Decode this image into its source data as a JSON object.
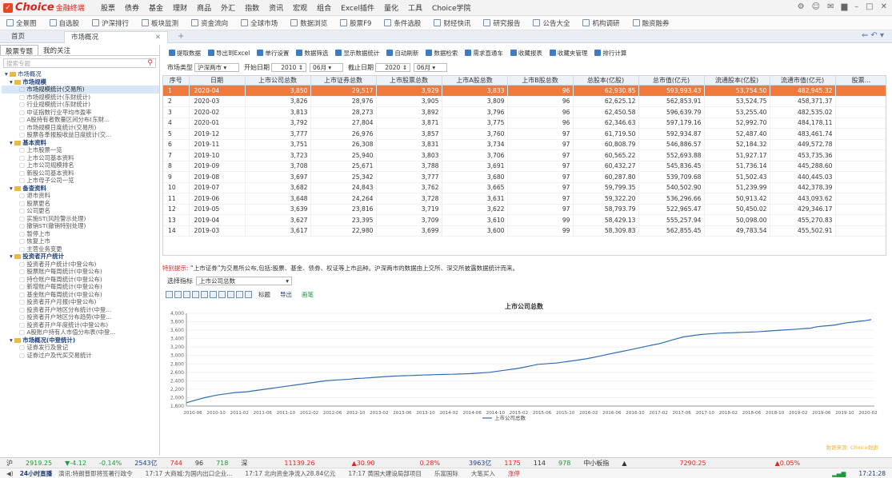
{
  "app": {
    "brand": "Choice",
    "brand_sub": "金融终端"
  },
  "menu": [
    "股票",
    "债券",
    "基金",
    "理财",
    "商品",
    "外汇",
    "指数",
    "资讯",
    "宏观",
    "组合",
    "Excel插件",
    "量化",
    "工具",
    "Choice学院"
  ],
  "toolbar": [
    "全景图",
    "自选股",
    "沪深排行",
    "板块监测",
    "资金流向",
    "全球市场",
    "数据浏览",
    "股票F9",
    "条件选股",
    "财经快讯",
    "研究报告",
    "公告大全",
    "机构调研",
    "融资融券"
  ],
  "tabs": {
    "home": "首页",
    "market": "市场概况"
  },
  "left": {
    "tab1": "股票专题",
    "tab2": "我的关注",
    "search_placeholder": "搜索专题"
  },
  "tree": [
    {
      "lv": "l0",
      "t": "市场概况"
    },
    {
      "lv": "l1",
      "t": "市场规模"
    },
    {
      "lv": "l2",
      "t": "市场规模统计(交易所)",
      "sel": true
    },
    {
      "lv": "l2",
      "t": "市场规模统计(东财统计)"
    },
    {
      "lv": "l2",
      "t": "行业规模统计(东财统计)"
    },
    {
      "lv": "l2",
      "t": "中证指数行业平均市盈率"
    },
    {
      "lv": "l2",
      "t": "A股持有者数量区间分布(东财..."
    },
    {
      "lv": "l2",
      "t": "市场规模日度统计(交易所)"
    },
    {
      "lv": "l2",
      "t": "股票各季报股收益日度统计(交..."
    },
    {
      "lv": "l1",
      "t": "基本资料"
    },
    {
      "lv": "l2",
      "t": "上市股票一览"
    },
    {
      "lv": "l2",
      "t": "上市公司基本资料"
    },
    {
      "lv": "l2",
      "t": "上市公司规模排名"
    },
    {
      "lv": "l2",
      "t": "新股公司基本资料"
    },
    {
      "lv": "l2",
      "t": "上市母子公司一览"
    },
    {
      "lv": "l1",
      "t": "备查资料"
    },
    {
      "lv": "l2",
      "t": "退市资料"
    },
    {
      "lv": "l2",
      "t": "股票更名"
    },
    {
      "lv": "l2",
      "t": "公司更名"
    },
    {
      "lv": "l2",
      "t": "实施ST(风险警示处理)"
    },
    {
      "lv": "l2",
      "t": "撤销ST(撤销特别处理)"
    },
    {
      "lv": "l2",
      "t": "暂停上市"
    },
    {
      "lv": "l2",
      "t": "恢复上市"
    },
    {
      "lv": "l2",
      "t": "主营业务变更"
    },
    {
      "lv": "l1",
      "t": "投资者开户统计"
    },
    {
      "lv": "l2",
      "t": "投资者开户统计(中登公布)"
    },
    {
      "lv": "l2",
      "t": "股票账户每周统计(中登公布)"
    },
    {
      "lv": "l2",
      "t": "持仓账户每周统计(中登公布)"
    },
    {
      "lv": "l2",
      "t": "新增账户每周统计(中登公布)"
    },
    {
      "lv": "l2",
      "t": "基金账户每周统计(中登公布)"
    },
    {
      "lv": "l2",
      "t": "投资者开户月报(中登公布)"
    },
    {
      "lv": "l2",
      "t": "投资者开户地区分布统计(中登..."
    },
    {
      "lv": "l2",
      "t": "投资者开户地区分布趋势(中登..."
    },
    {
      "lv": "l2",
      "t": "投资者开户年度统计(中登公布)"
    },
    {
      "lv": "l2",
      "t": "A股账户持有人市值分布表(中登..."
    },
    {
      "lv": "l1",
      "t": "市场概况(中登统计)"
    },
    {
      "lv": "l2",
      "t": "证券发行及登记"
    },
    {
      "lv": "l2",
      "t": "证券过户及代买交易统计"
    }
  ],
  "actions": [
    "提取数据",
    "导出到Excel",
    "单行设置",
    "数据筛选",
    "显示数据统计",
    "自动刷新",
    "数据检索",
    "需求直通车",
    "收藏报表",
    "收藏夹管理",
    "排行计算"
  ],
  "filters": {
    "market_label": "市场类型",
    "market": "沪深两市",
    "start_label": "开始日期",
    "start_year": "2010",
    "start_month": "06月",
    "end_label": "截止日期",
    "end_year": "2020",
    "end_month": "06月"
  },
  "table": {
    "headers": [
      "序号",
      "日期",
      "上市公司总数",
      "上市证券总数",
      "上市股票总数",
      "上市A股总数",
      "上市B股总数",
      "总股本(亿股)",
      "总市值(亿元)",
      "流通股本(亿股)",
      "流通市值(亿元)",
      "股票..."
    ],
    "rows": [
      [
        "1",
        "2020-04",
        "3,850",
        "29,517",
        "3,929",
        "3,833",
        "96",
        "62,930.85",
        "593,993.43",
        "53,754.50",
        "482,945.32"
      ],
      [
        "2",
        "2020-03",
        "3,826",
        "28,976",
        "3,905",
        "3,809",
        "96",
        "62,625.12",
        "562,853.91",
        "53,524.75",
        "458,371.37"
      ],
      [
        "3",
        "2020-02",
        "3,813",
        "28,273",
        "3,892",
        "3,796",
        "96",
        "62,450.58",
        "596,639.79",
        "53,255.40",
        "482,535.02"
      ],
      [
        "4",
        "2020-01",
        "3,792",
        "27,804",
        "3,871",
        "3,775",
        "96",
        "62,346.63",
        "597,179.16",
        "52,992.70",
        "484,178.11"
      ],
      [
        "5",
        "2019-12",
        "3,777",
        "26,976",
        "3,857",
        "3,760",
        "97",
        "61,719.50",
        "592,934.87",
        "52,487.40",
        "483,461.74"
      ],
      [
        "6",
        "2019-11",
        "3,751",
        "26,308",
        "3,831",
        "3,734",
        "97",
        "60,808.79",
        "546,886.57",
        "52,184.32",
        "449,572.78"
      ],
      [
        "7",
        "2019-10",
        "3,723",
        "25,940",
        "3,803",
        "3,706",
        "97",
        "60,565.22",
        "552,693.88",
        "51,927.17",
        "453,735.36"
      ],
      [
        "8",
        "2019-09",
        "3,708",
        "25,671",
        "3,788",
        "3,691",
        "97",
        "60,432.27",
        "545,836.45",
        "51,736.14",
        "445,288.60"
      ],
      [
        "9",
        "2019-08",
        "3,697",
        "25,342",
        "3,777",
        "3,680",
        "97",
        "60,287.80",
        "539,709.68",
        "51,502.43",
        "440,445.03"
      ],
      [
        "10",
        "2019-07",
        "3,682",
        "24,843",
        "3,762",
        "3,665",
        "97",
        "59,799.35",
        "540,502.90",
        "51,239.99",
        "442,378.39"
      ],
      [
        "11",
        "2019-06",
        "3,648",
        "24,264",
        "3,728",
        "3,631",
        "97",
        "59,322.20",
        "536,296.66",
        "50,913.42",
        "443,093.62"
      ],
      [
        "12",
        "2019-05",
        "3,639",
        "23,816",
        "3,719",
        "3,622",
        "97",
        "58,793.79",
        "522,965.47",
        "50,450.02",
        "429,346.17"
      ],
      [
        "13",
        "2019-04",
        "3,627",
        "23,395",
        "3,709",
        "3,610",
        "99",
        "58,429.13",
        "555,257.94",
        "50,098.00",
        "455,270.83"
      ],
      [
        "14",
        "2019-03",
        "3,617",
        "22,980",
        "3,699",
        "3,600",
        "99",
        "58,309.83",
        "562,855.45",
        "49,783.54",
        "455,502.91"
      ]
    ]
  },
  "note": {
    "label": "特别提示:",
    "text": " “上市证券”为交易所公布,包括:股票、基金、债券、权证等上市品种。沪深两市的数据由上交所、深交所披露数据统计而来。"
  },
  "indicator": {
    "label": "选择指标",
    "value": "上市公司总数"
  },
  "chart_tools": {
    "title_btn": "标题",
    "export": "导出",
    "pen": "画笔"
  },
  "chart_data": {
    "type": "line",
    "title": "上市公司总数",
    "legend": "上市公司总数",
    "ylim": [
      1800,
      4000
    ],
    "yticks": [
      "4,000",
      "3,800",
      "3,600",
      "3,400",
      "3,200",
      "3,000",
      "2,800",
      "2,600",
      "2,400",
      "2,200",
      "2,000",
      "1,800"
    ],
    "xticks": [
      "2010-06",
      "2010-10",
      "2011-02",
      "2011-06",
      "2011-10",
      "2012-02",
      "2012-06",
      "2012-10",
      "2013-02",
      "2013-06",
      "2013-10",
      "2014-02",
      "2014-06",
      "2014-10",
      "2015-02",
      "2015-06",
      "2015-10",
      "2016-02",
      "2016-06",
      "2016-10",
      "2017-02",
      "2017-06",
      "2017-10",
      "2018-02",
      "2018-06",
      "2018-10",
      "2019-02",
      "2019-06",
      "2019-10",
      "2020-02"
    ],
    "x_start": "2010-06",
    "x_end": "2020-04",
    "values": [
      1880,
      1920,
      1960,
      2000,
      2030,
      2060,
      2080,
      2100,
      2120,
      2130,
      2140,
      2160,
      2180,
      2200,
      2220,
      2240,
      2260,
      2280,
      2300,
      2320,
      2340,
      2360,
      2380,
      2400,
      2410,
      2420,
      2430,
      2440,
      2455,
      2460,
      2470,
      2480,
      2490,
      2500,
      2510,
      2515,
      2520,
      2525,
      2530,
      2535,
      2540,
      2545,
      2550,
      2552,
      2555,
      2560,
      2565,
      2570,
      2580,
      2590,
      2600,
      2620,
      2640,
      2660,
      2680,
      2700,
      2730,
      2760,
      2790,
      2800,
      2810,
      2820,
      2840,
      2860,
      2880,
      2900,
      2920,
      2950,
      2980,
      3010,
      3040,
      3070,
      3100,
      3130,
      3160,
      3190,
      3220,
      3250,
      3280,
      3320,
      3360,
      3400,
      3440,
      3460,
      3480,
      3500,
      3510,
      3520,
      3530,
      3535,
      3540,
      3545,
      3550,
      3555,
      3560,
      3570,
      3580,
      3590,
      3600,
      3610,
      3617,
      3627,
      3639,
      3648,
      3682,
      3697,
      3708,
      3723,
      3751,
      3777,
      3792,
      3813,
      3826,
      3850
    ]
  },
  "watermark": "数据来源: Choice数据",
  "status": {
    "sh": "沪",
    "idx": "2919.25",
    "chg": "-4.12",
    "pct": "-0.14%",
    "amt": "2543亿",
    "up": "744",
    "flat": "96",
    "down": "718",
    "sz": "深",
    "idx2": "11139.26",
    "chg2": "30.90",
    "pct2": "0.28%",
    "amt2": "3963亿",
    "up2": "1175",
    "flat2": "114",
    "down2": "978",
    "board": "中小板指",
    "idx3": "7290.25",
    "pct3": "0.05%"
  },
  "ticker": {
    "live": "24小时直播",
    "items": [
      "演讯:特朗普即将签署行政令",
      "17:17 大商城:为国内出口企业...",
      "17:17 北向资金净流入28.84亿元",
      "17:17 黄国大建设局部项目"
    ],
    "time": "17:21:28",
    "f1": "乐富国际",
    "f2": "大笔买入",
    "f3": "涨停"
  }
}
